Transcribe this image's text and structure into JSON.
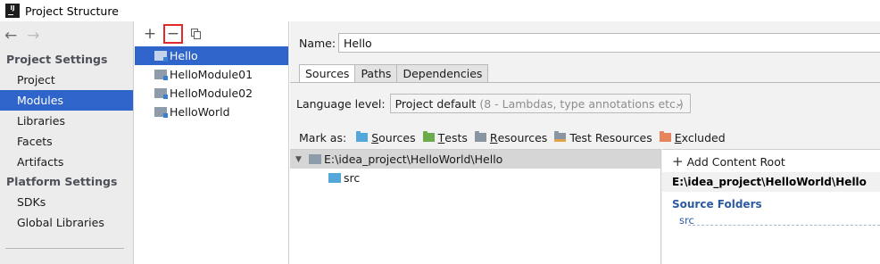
{
  "window": {
    "app_icon_text": "IJ",
    "title": "Project Structure"
  },
  "sidebar": {
    "back_icon": "←",
    "forward_icon": "→",
    "project_settings_header": "Project Settings",
    "project_settings": [
      "Project",
      "Modules",
      "Libraries",
      "Facets",
      "Artifacts"
    ],
    "platform_settings_header": "Platform Settings",
    "platform_settings": [
      "SDKs",
      "Global Libraries"
    ],
    "selected": "Modules"
  },
  "modules_panel": {
    "toolbar": {
      "add_icon": "+",
      "remove_icon": "−",
      "copy_icon": "copy"
    },
    "modules": [
      "Hello",
      "HelloModule01",
      "HelloModule02",
      "HelloWorld"
    ],
    "selected": "Hello"
  },
  "details": {
    "name_label": "Name:",
    "name_value": "Hello",
    "tabs": [
      "Sources",
      "Paths",
      "Dependencies"
    ],
    "active_tab": "Sources",
    "language_level_label": "Language level:",
    "language_level_value": "Project default",
    "language_level_hint": "(8 - Lambdas, type annotations etc.)",
    "chevron_icon": "⌄",
    "mark_as_label": "Mark as:",
    "mark_as": [
      {
        "label_first": "S",
        "label_rest": "ources",
        "color": "#54a7d9"
      },
      {
        "label_first": "T",
        "label_rest": "ests",
        "color": "#6aac4c"
      },
      {
        "label_first": "R",
        "label_rest": "esources",
        "color": "#8a95a3"
      },
      {
        "label_first": "",
        "label_rest": "Test Resources",
        "color": "#8a95a3"
      },
      {
        "label_first": "E",
        "label_rest": "xcluded",
        "color": "#e5845d"
      }
    ],
    "tree": {
      "expand_icon": "▼",
      "root": "E:\\idea_project\\HelloWorld\\Hello",
      "children": [
        "src"
      ]
    },
    "content_root": {
      "add_label": "Add Content Root",
      "plus_icon": "+",
      "path": "E:\\idea_project\\HelloWorld\\Hello",
      "source_folders_header": "Source Folders",
      "source_folders": [
        "src"
      ]
    }
  },
  "colors": {
    "selection": "#2f65ca",
    "highlight_box": "#e12a2a",
    "source_folder": "#54a7d9",
    "module_folder": "#8e9bab"
  }
}
